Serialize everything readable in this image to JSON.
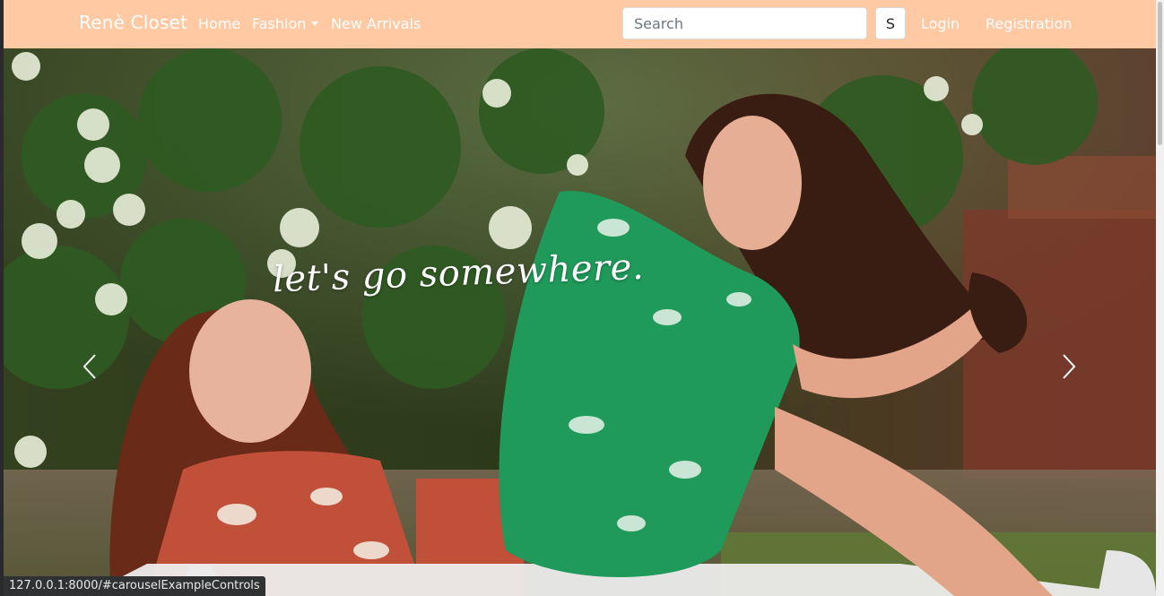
{
  "navbar": {
    "brand": "Renè Closet",
    "links": {
      "home": "Home",
      "fashion": "Fashion",
      "new_arrivals": "New Arrivals",
      "login": "Login",
      "registration": "Registration"
    },
    "search": {
      "placeholder": "Search",
      "button_label": "S"
    }
  },
  "carousel": {
    "caption": "let's go somewhere.",
    "prev_icon": "chevron-left-icon",
    "next_icon": "chevron-right-icon"
  },
  "status_bar": {
    "url": "127.0.0.1:8000/#carouselExampleControls"
  },
  "colors": {
    "navbar_bg": "#ffc9a3",
    "nav_text": "#ffffff"
  }
}
